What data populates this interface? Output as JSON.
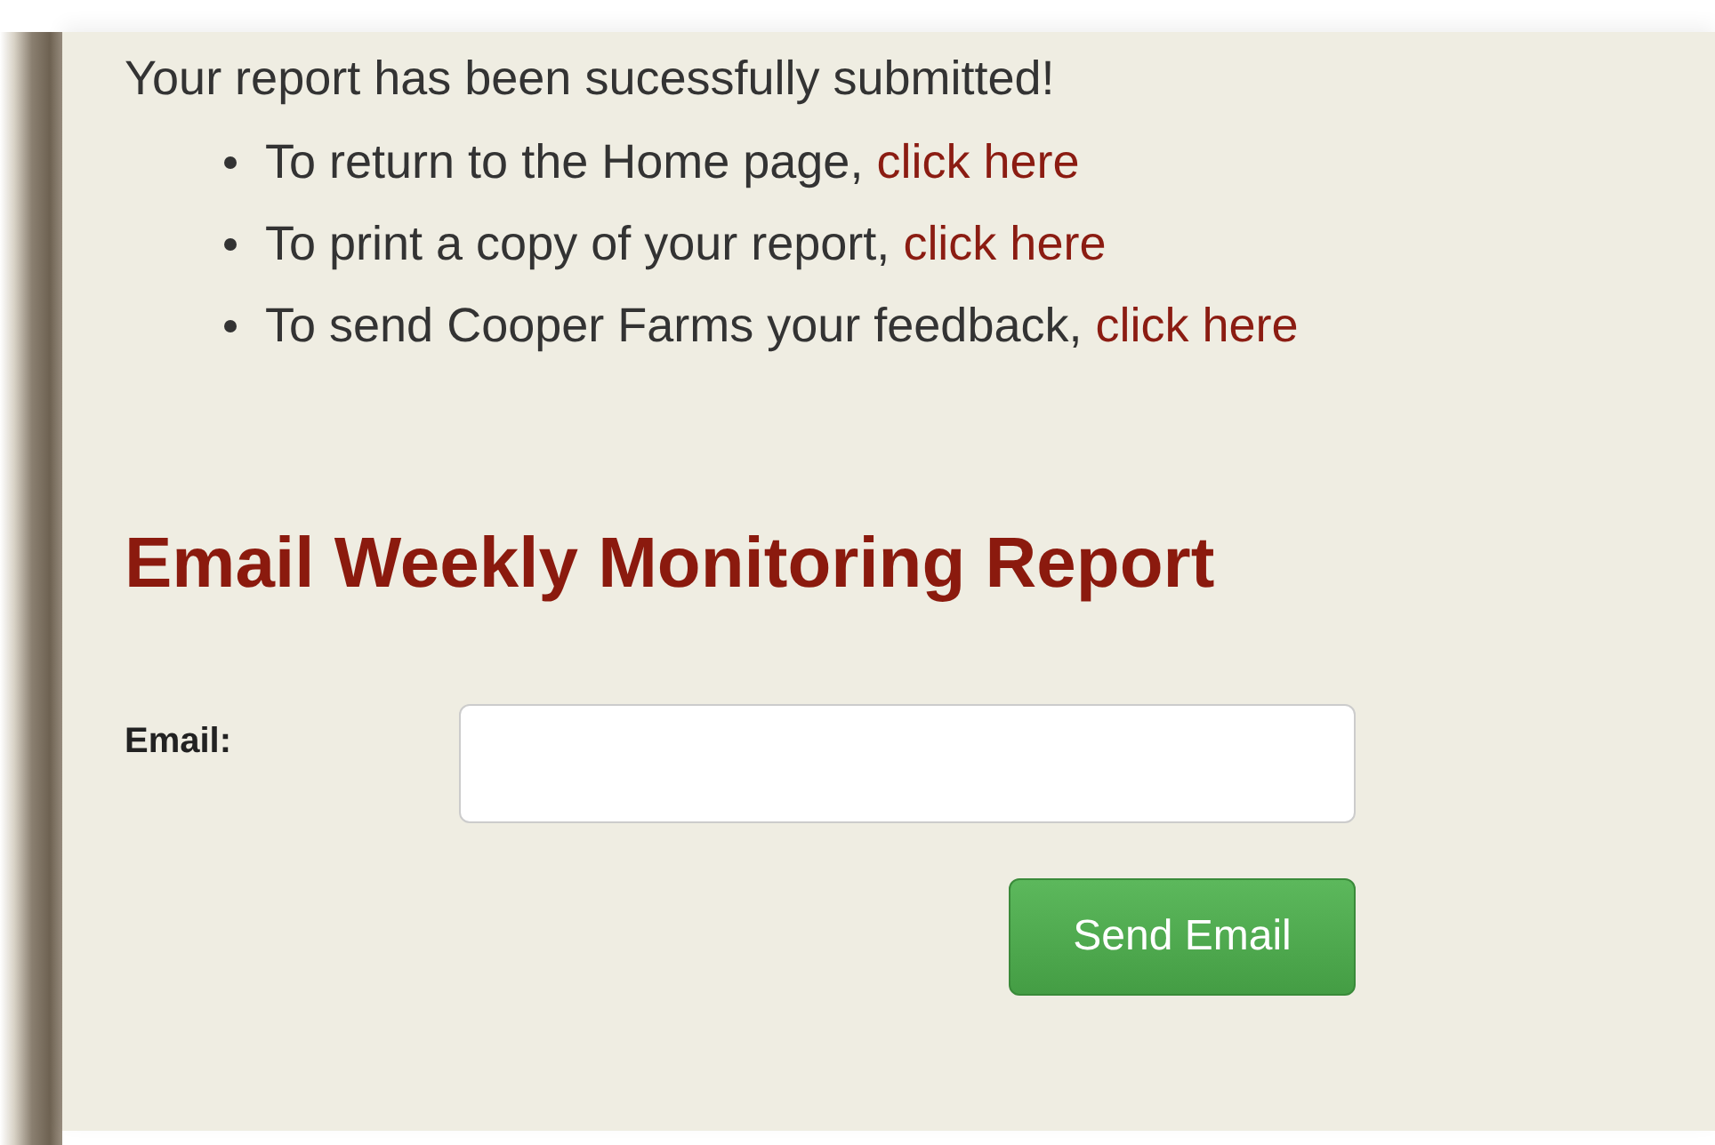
{
  "message": "Your report has been sucessfully submitted!",
  "links": [
    {
      "text": "To return to the Home page,",
      "link": "click here"
    },
    {
      "text": "To print a copy of your report,",
      "link": "click here"
    },
    {
      "text": "To send Cooper Farms your feedback,",
      "link": "click here"
    }
  ],
  "heading": "Email Weekly Monitoring Report",
  "form": {
    "label": "Email:",
    "button": "Send Email"
  }
}
